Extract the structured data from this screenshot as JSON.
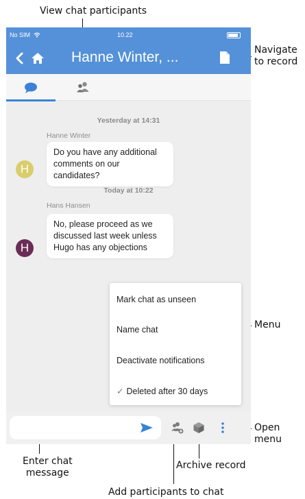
{
  "callouts": {
    "view_participants": "View chat participants",
    "navigate_record_line1": "Navigate",
    "navigate_record_line2": "to record",
    "menu": "Menu",
    "open_menu_line1": "Open",
    "open_menu_line2": "menu",
    "enter_message_line1": "Enter chat",
    "enter_message_line2": "message",
    "archive_record": "Archive record",
    "add_participants": "Add participants to chat"
  },
  "status_bar": {
    "carrier": "No SIM",
    "time": "10.22"
  },
  "nav": {
    "title": "Hanne Winter, ...",
    "back_icon": "chevron-left-icon",
    "home_icon": "home-icon",
    "record_icon": "document-icon"
  },
  "tabs": [
    {
      "icon": "chat-bubble-icon",
      "active": true
    },
    {
      "icon": "people-icon",
      "active": false
    }
  ],
  "conversation": [
    {
      "timestamp": "Yesterday at 14:31",
      "sender": "Hanne Winter",
      "initial": "H",
      "avatar_color": "#d9cd6c",
      "text_lines": [
        "Do you have any additional",
        "comments on our candidates?"
      ]
    },
    {
      "timestamp": "Today at 10:22",
      "sender": "Hans Hansen",
      "initial": "H",
      "avatar_color": "#6b2d55",
      "text_lines": [
        "No, please proceed as we",
        "discussed last week unless",
        "Hugo has any objections"
      ]
    }
  ],
  "menu": {
    "items": [
      {
        "label": "Mark chat as unseen",
        "checked": false
      },
      {
        "label": "Name chat",
        "checked": false
      },
      {
        "label": "Deactivate notifications",
        "checked": false
      },
      {
        "label": "Deleted after 30 days",
        "checked": true
      }
    ],
    "check_glyph": "✓"
  },
  "composer": {
    "placeholder": "",
    "send_icon": "send-icon",
    "add_participants_icon": "add-person-icon",
    "archive_icon": "archive-box-icon",
    "menu_icon": "kebab-menu-icon"
  },
  "colors": {
    "header": "#5591d8",
    "accent": "#3b82d6",
    "icon_gray": "#7d7d7d",
    "background": "#eeeeee"
  }
}
